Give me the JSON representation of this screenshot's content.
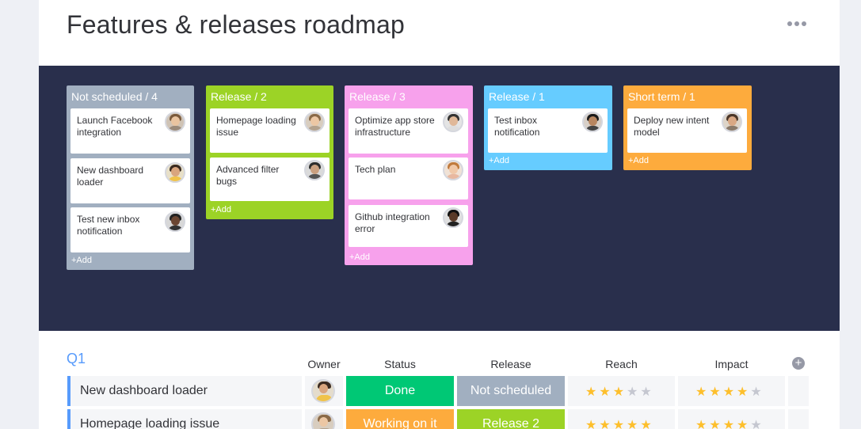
{
  "header": {
    "title": "Features & releases roadmap",
    "more_icon": "more-horizontal-icon"
  },
  "columns": [
    {
      "label": "Not scheduled / 4",
      "color": "#a1afc0",
      "cards": [
        {
          "text": "Launch Facebook integration"
        },
        {
          "text": "New dashboard loader"
        },
        {
          "text": "Test new inbox notification"
        }
      ],
      "add": "+Add"
    },
    {
      "label": "Release / 2",
      "color": "#9cd326",
      "cards": [
        {
          "text": "Homepage loading issue"
        },
        {
          "text": "Advanced filter bugs"
        }
      ],
      "add": "+Add"
    },
    {
      "label": "Release / 3",
      "color": "#f7a1ec",
      "cards": [
        {
          "text": "Optimize app store infrastructure"
        },
        {
          "text": "Tech plan"
        },
        {
          "text": "Github integration error"
        }
      ],
      "add": "+Add"
    },
    {
      "label": "Release / 1",
      "color": "#66ccff",
      "cards": [
        {
          "text": "Test inbox notification"
        }
      ],
      "add": "+Add"
    },
    {
      "label": "Short term / 1",
      "color": "#fdab3d",
      "cards": [
        {
          "text": "Deploy new intent model"
        }
      ],
      "add": "+Add"
    }
  ],
  "table": {
    "group_title": "Q1",
    "headers": {
      "owner": "Owner",
      "status": "Status",
      "release": "Release",
      "reach": "Reach",
      "impact": "Impact"
    },
    "rows": [
      {
        "name": "New dashboard loader",
        "status": "Done",
        "status_color": "#00c875",
        "release": "Not scheduled",
        "release_color": "#a1afc0",
        "reach": 3,
        "impact": 4
      },
      {
        "name": "Homepage loading issue",
        "status": "Working on it",
        "status_color": "#fdab3d",
        "release": "Release 2",
        "release_color": "#9cd326",
        "reach": 5,
        "impact": 4
      }
    ],
    "max_stars": 5,
    "star_color": "#fdbf2c"
  }
}
